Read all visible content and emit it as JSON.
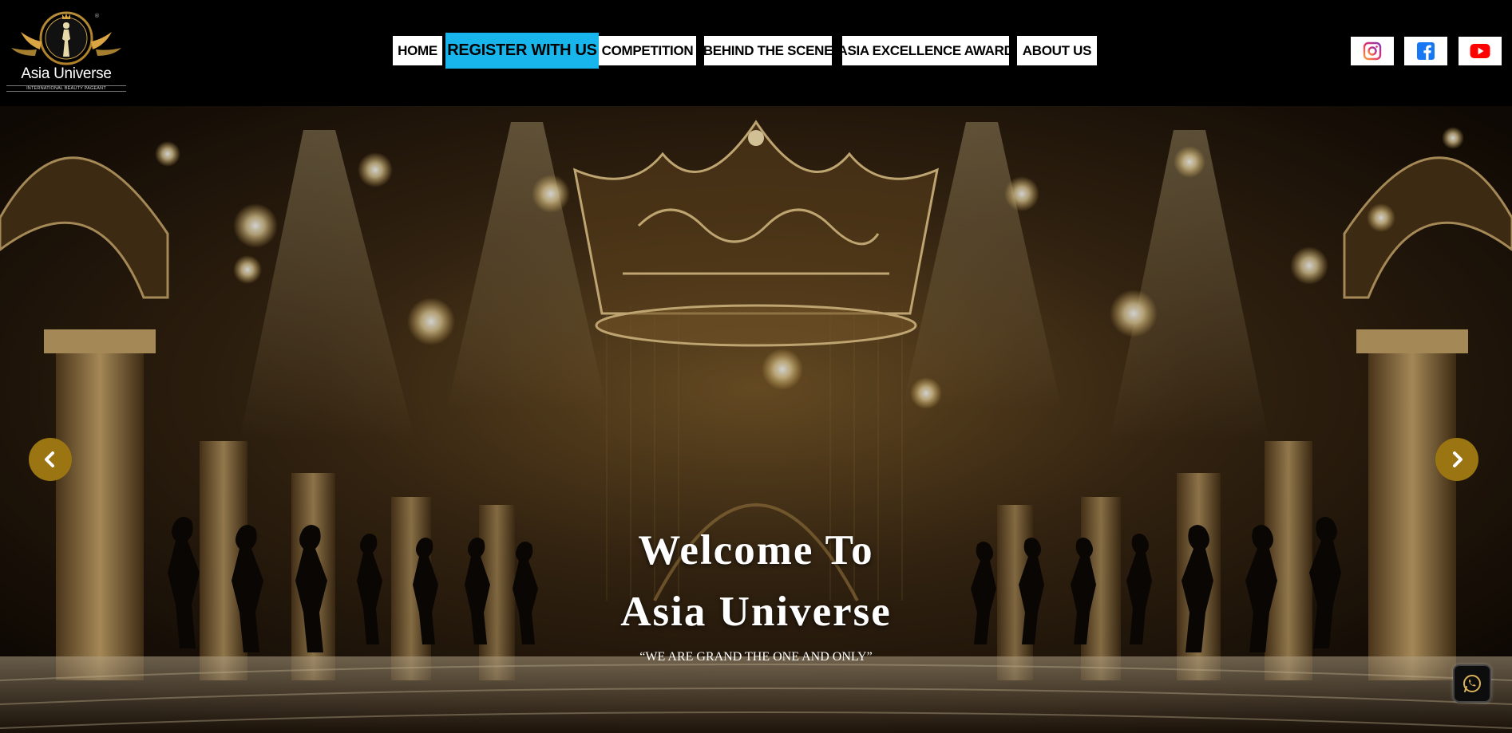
{
  "logo": {
    "title": "Asia Universe",
    "subtitle": "INTERNATIONAL BEAUTY PAGEANT"
  },
  "nav": {
    "items": [
      {
        "label": "HOME",
        "active": false
      },
      {
        "label": "REGISTER WITH US",
        "active": true
      },
      {
        "label": "COMPETITION",
        "active": false
      },
      {
        "label": "BEHIND THE SCENE",
        "active": false
      },
      {
        "label": "ASIA EXCELLENCE AWARD",
        "active": false
      },
      {
        "label": "ABOUT US",
        "active": false
      }
    ]
  },
  "social": {
    "icons": [
      "instagram-icon",
      "facebook-icon",
      "youtube-icon"
    ]
  },
  "hero": {
    "title_line1": "Welcome To",
    "title_line2": "Asia Universe",
    "tagline": "“WE ARE GRAND THE ONE AND ONLY”"
  },
  "colors": {
    "header_bg": "#000000",
    "active_nav": "#17b5ec",
    "arrow_bg": "#9a7512",
    "gold": "#d9a441",
    "instagram": "#e1306c",
    "facebook": "#1877f2",
    "youtube": "#ff0000"
  }
}
